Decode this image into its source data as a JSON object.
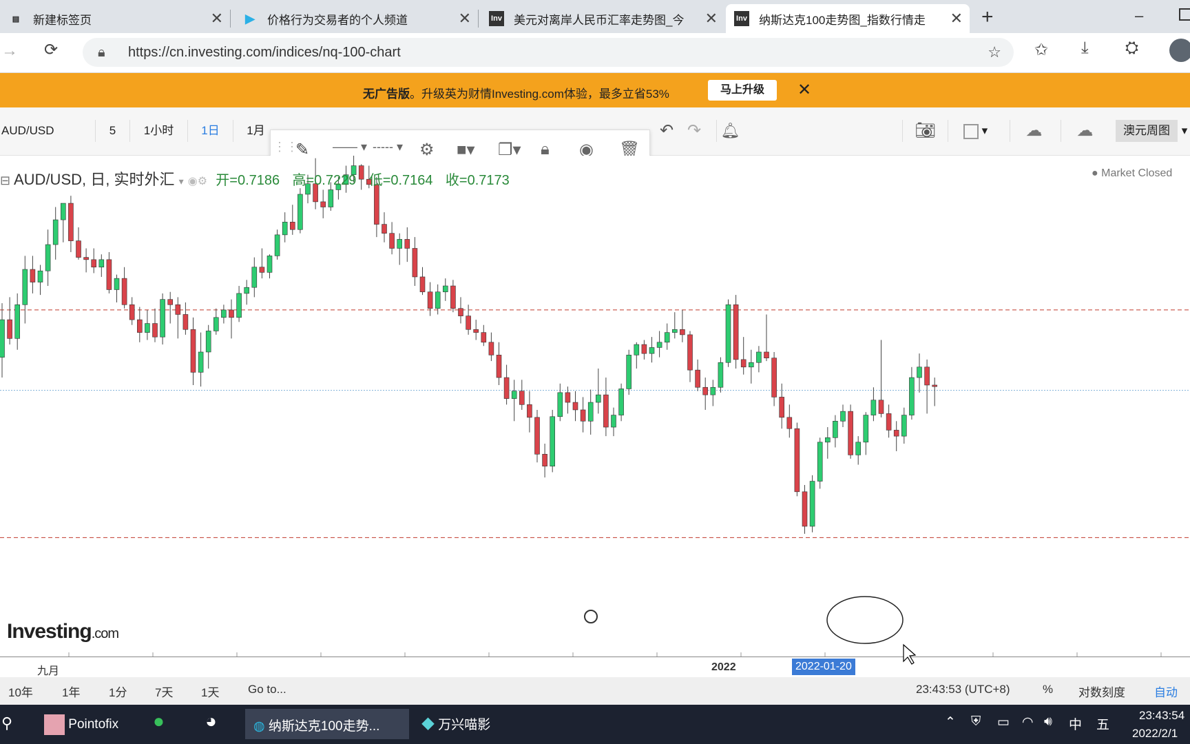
{
  "browser": {
    "tabs": [
      {
        "title": "新建标签页",
        "icon": "page-icon"
      },
      {
        "title": "价格行为交易者的个人频道",
        "icon": "play-icon"
      },
      {
        "title": "美元对离岸人民币汇率走势图_今",
        "icon": "Inv"
      },
      {
        "title": "纳斯达克100走势图_指数行情走",
        "icon": "Inv"
      }
    ],
    "url": "https://cn.investing.com/indices/nq-100-chart"
  },
  "promo": {
    "text_bold": "无广告版",
    "text": "。升级英为财情Investing.com体验，最多立省53%",
    "button": "马上升级"
  },
  "toolbar": {
    "symbol": "AUD/USD",
    "intervals": [
      "5",
      "1小时",
      "1日",
      "1月"
    ],
    "active_interval": "1日",
    "layout_label": "澳元周图"
  },
  "legend": {
    "title": "AUD/USD, 日, 实时外汇",
    "open": "开=0.7186",
    "high": "高=0.7229",
    "low": "低=0.7164",
    "close": "收=0.7173",
    "status": "Market Closed"
  },
  "logo": {
    "main": "Investing",
    "suffix": ".com"
  },
  "xaxis": {
    "labels": [
      "九月",
      "2022"
    ],
    "crosshair_date": "2022-01-20"
  },
  "rangebar": {
    "ranges": [
      "10年",
      "1年",
      "1分",
      "7天",
      "1天",
      "Go to..."
    ],
    "time": "23:43:53 (UTC+8)",
    "percent": "%",
    "log": "对数刻度",
    "auto": "自动"
  },
  "taskbar": {
    "apps": [
      "Pointofix",
      "纳斯达克100走势...",
      "万兴喵影"
    ],
    "clock_time": "23:43:54",
    "clock_date": "2022/2/1",
    "ime": "中",
    "ime2": "五"
  },
  "chart_data": {
    "type": "candlestick",
    "up_color": "#2ecc71",
    "down_color": "#d9434a",
    "title": "AUD/USD, 日, 实时外汇",
    "ylim": [
      0.6995,
      0.7625
    ],
    "horizontal_levels": [
      0.7438,
      0.7331,
      0.7135
    ],
    "candles": [
      [
        0.7375,
        0.7447,
        0.7348,
        0.7425
      ],
      [
        0.7425,
        0.7455,
        0.7392,
        0.74
      ],
      [
        0.74,
        0.746,
        0.7385,
        0.7445
      ],
      [
        0.7445,
        0.751,
        0.742,
        0.7492
      ],
      [
        0.7492,
        0.751,
        0.746,
        0.7475
      ],
      [
        0.7475,
        0.7498,
        0.7458,
        0.749
      ],
      [
        0.749,
        0.7545,
        0.747,
        0.7525
      ],
      [
        0.7525,
        0.7575,
        0.7505,
        0.7558
      ],
      [
        0.7558,
        0.7572,
        0.7528,
        0.758
      ],
      [
        0.758,
        0.759,
        0.7515,
        0.753
      ],
      [
        0.753,
        0.7548,
        0.7505,
        0.7508
      ],
      [
        0.7508,
        0.752,
        0.7488,
        0.7505
      ],
      [
        0.7505,
        0.752,
        0.7487,
        0.7495
      ],
      [
        0.7495,
        0.7512,
        0.7482,
        0.7505
      ],
      [
        0.7505,
        0.7515,
        0.746,
        0.7465
      ],
      [
        0.7465,
        0.7485,
        0.7448,
        0.748
      ],
      [
        0.748,
        0.7495,
        0.744,
        0.7445
      ],
      [
        0.7445,
        0.7455,
        0.7418,
        0.7425
      ],
      [
        0.7425,
        0.7442,
        0.7395,
        0.7408
      ],
      [
        0.7408,
        0.7438,
        0.7398,
        0.742
      ],
      [
        0.742,
        0.744,
        0.7395,
        0.7402
      ],
      [
        0.7402,
        0.746,
        0.7392,
        0.7452
      ],
      [
        0.7452,
        0.7462,
        0.742,
        0.7445
      ],
      [
        0.7445,
        0.7455,
        0.74,
        0.7432
      ],
      [
        0.7432,
        0.7448,
        0.7405,
        0.7412
      ],
      [
        0.7412,
        0.7428,
        0.7338,
        0.7355
      ],
      [
        0.7355,
        0.7408,
        0.7336,
        0.7382
      ],
      [
        0.7382,
        0.7418,
        0.736,
        0.741
      ],
      [
        0.741,
        0.744,
        0.7405,
        0.7428
      ],
      [
        0.7428,
        0.7445,
        0.742,
        0.7438
      ],
      [
        0.7438,
        0.7452,
        0.74,
        0.7428
      ],
      [
        0.7428,
        0.747,
        0.7422,
        0.746
      ],
      [
        0.746,
        0.7478,
        0.7445,
        0.7468
      ],
      [
        0.7468,
        0.7508,
        0.7455,
        0.7495
      ],
      [
        0.7495,
        0.752,
        0.748,
        0.7488
      ],
      [
        0.7488,
        0.7512,
        0.748,
        0.751
      ],
      [
        0.751,
        0.7545,
        0.7505,
        0.7538
      ],
      [
        0.7538,
        0.7568,
        0.7528,
        0.7555
      ],
      [
        0.7555,
        0.7578,
        0.7538,
        0.7545
      ],
      [
        0.7545,
        0.76,
        0.754,
        0.7592
      ],
      [
        0.7592,
        0.7618,
        0.758,
        0.7606
      ],
      [
        0.7606,
        0.764,
        0.7572,
        0.7582
      ],
      [
        0.7582,
        0.7598,
        0.756,
        0.7575
      ],
      [
        0.7575,
        0.7608,
        0.757,
        0.7598
      ],
      [
        0.7598,
        0.7615,
        0.7585,
        0.7605
      ],
      [
        0.7605,
        0.763,
        0.7594,
        0.7618
      ],
      [
        0.7618,
        0.7645,
        0.7608,
        0.763
      ],
      [
        0.763,
        0.7632,
        0.7598,
        0.7612
      ],
      [
        0.7612,
        0.763,
        0.76,
        0.7605
      ],
      [
        0.7605,
        0.7615,
        0.7535,
        0.7552
      ],
      [
        0.7552,
        0.7568,
        0.7528,
        0.754
      ],
      [
        0.754,
        0.7555,
        0.7512,
        0.752
      ],
      [
        0.752,
        0.754,
        0.7498,
        0.7532
      ],
      [
        0.7532,
        0.7548,
        0.7502,
        0.752
      ],
      [
        0.752,
        0.7535,
        0.747,
        0.7482
      ],
      [
        0.7482,
        0.7495,
        0.7458,
        0.7462
      ],
      [
        0.7462,
        0.7475,
        0.743,
        0.744
      ],
      [
        0.744,
        0.7472,
        0.7432,
        0.7462
      ],
      [
        0.7462,
        0.748,
        0.745,
        0.747
      ],
      [
        0.747,
        0.7478,
        0.7435,
        0.744
      ],
      [
        0.744,
        0.7455,
        0.742,
        0.743
      ],
      [
        0.743,
        0.7445,
        0.7405,
        0.7412
      ],
      [
        0.7412,
        0.7425,
        0.7398,
        0.7408
      ],
      [
        0.7408,
        0.7418,
        0.739,
        0.7395
      ],
      [
        0.7395,
        0.7408,
        0.737,
        0.7378
      ],
      [
        0.7378,
        0.7395,
        0.7338,
        0.7348
      ],
      [
        0.7348,
        0.7365,
        0.7312,
        0.732
      ],
      [
        0.732,
        0.7345,
        0.729,
        0.733
      ],
      [
        0.733,
        0.7345,
        0.7305,
        0.7312
      ],
      [
        0.7312,
        0.733,
        0.7275,
        0.7295
      ],
      [
        0.7295,
        0.7305,
        0.7235,
        0.7246
      ],
      [
        0.7246,
        0.726,
        0.7215,
        0.723
      ],
      [
        0.723,
        0.7305,
        0.7222,
        0.7296
      ],
      [
        0.7296,
        0.734,
        0.729,
        0.7328
      ],
      [
        0.7328,
        0.7336,
        0.73,
        0.7315
      ],
      [
        0.7315,
        0.733,
        0.729,
        0.7305
      ],
      [
        0.7305,
        0.7322,
        0.7275,
        0.729
      ],
      [
        0.729,
        0.7332,
        0.7272,
        0.7315
      ],
      [
        0.7315,
        0.736,
        0.73,
        0.7325
      ],
      [
        0.7325,
        0.7348,
        0.727,
        0.7282
      ],
      [
        0.7282,
        0.7308,
        0.727,
        0.7298
      ],
      [
        0.7298,
        0.734,
        0.729,
        0.7333
      ],
      [
        0.7333,
        0.7385,
        0.7325,
        0.7378
      ],
      [
        0.7378,
        0.7395,
        0.736,
        0.7392
      ],
      [
        0.7392,
        0.7398,
        0.7372,
        0.738
      ],
      [
        0.738,
        0.7402,
        0.7368,
        0.7388
      ],
      [
        0.7388,
        0.741,
        0.7375,
        0.7395
      ],
      [
        0.7395,
        0.742,
        0.7385,
        0.7408
      ],
      [
        0.7408,
        0.7435,
        0.74,
        0.7412
      ],
      [
        0.7412,
        0.7438,
        0.7395,
        0.7405
      ],
      [
        0.7405,
        0.741,
        0.7342,
        0.7358
      ],
      [
        0.7358,
        0.7372,
        0.733,
        0.7335
      ],
      [
        0.7335,
        0.7348,
        0.7305,
        0.7325
      ],
      [
        0.7325,
        0.7345,
        0.731,
        0.7335
      ],
      [
        0.7335,
        0.7375,
        0.7328,
        0.7368
      ],
      [
        0.7368,
        0.7452,
        0.7362,
        0.7445
      ],
      [
        0.7445,
        0.7458,
        0.736,
        0.7372
      ],
      [
        0.7372,
        0.7402,
        0.7352,
        0.7362
      ],
      [
        0.7362,
        0.7385,
        0.734,
        0.7368
      ],
      [
        0.7368,
        0.739,
        0.7355,
        0.7382
      ],
      [
        0.7382,
        0.7432,
        0.737,
        0.7374
      ],
      [
        0.7374,
        0.7382,
        0.731,
        0.7322
      ],
      [
        0.7322,
        0.734,
        0.728,
        0.7295
      ],
      [
        0.7295,
        0.7312,
        0.7268,
        0.728
      ],
      [
        0.728,
        0.7288,
        0.719,
        0.7196
      ],
      [
        0.7196,
        0.7205,
        0.714,
        0.715
      ],
      [
        0.715,
        0.7218,
        0.7142,
        0.721
      ],
      [
        0.721,
        0.7268,
        0.72,
        0.7262
      ],
      [
        0.7262,
        0.7282,
        0.724,
        0.7268
      ],
      [
        0.7268,
        0.7298,
        0.7255,
        0.729
      ],
      [
        0.729,
        0.7312,
        0.7282,
        0.7303
      ],
      [
        0.7303,
        0.7312,
        0.724,
        0.7245
      ],
      [
        0.7245,
        0.727,
        0.7232,
        0.7262
      ],
      [
        0.7262,
        0.7302,
        0.7245,
        0.7298
      ],
      [
        0.7298,
        0.7335,
        0.729,
        0.7318
      ],
      [
        0.7318,
        0.7398,
        0.7295,
        0.73
      ],
      [
        0.73,
        0.7312,
        0.7268,
        0.7278
      ],
      [
        0.7278,
        0.729,
        0.725,
        0.727
      ],
      [
        0.727,
        0.7308,
        0.726,
        0.7298
      ],
      [
        0.7298,
        0.7362,
        0.7292,
        0.7348
      ],
      [
        0.7348,
        0.738,
        0.7328,
        0.7362
      ],
      [
        0.7362,
        0.7372,
        0.73,
        0.7338
      ],
      [
        0.7338,
        0.7348,
        0.731,
        0.7336
      ]
    ]
  }
}
